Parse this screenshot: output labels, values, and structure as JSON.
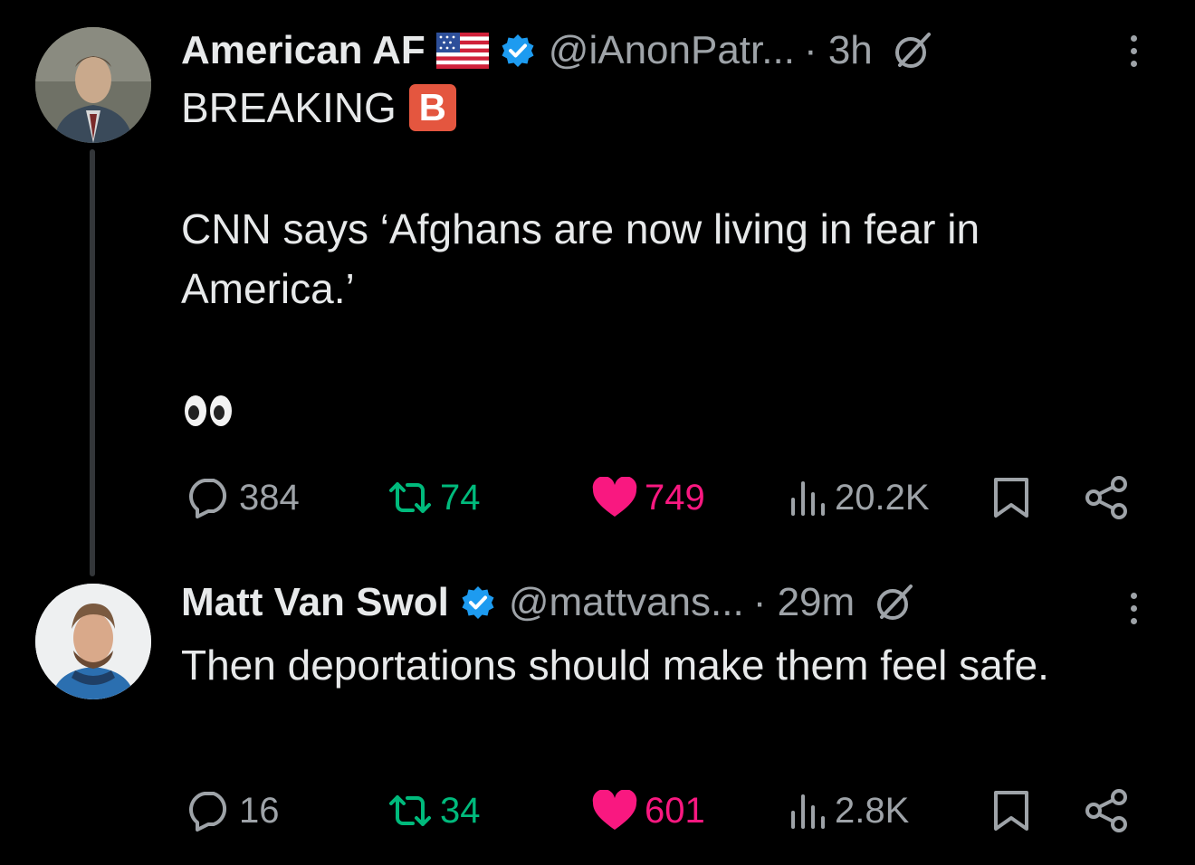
{
  "tweets": [
    {
      "display_name": "American AF",
      "handle": "@iAnonPatr...",
      "time": "· 3h",
      "badge_letter": "B",
      "line1": "BREAKING",
      "body": "CNN says ‘Afghans are now living in fear in America.’",
      "emoji": "👀",
      "replies": "384",
      "reposts": "74",
      "likes": "749",
      "views": "20.2K"
    },
    {
      "display_name": "Matt Van Swol",
      "handle": "@mattvans...",
      "time": "· 29m",
      "body": "Then deportations should make them feel safe.",
      "replies": "16",
      "reposts": "34",
      "likes": "601",
      "views": "2.8K"
    }
  ],
  "icons": {
    "verified": "verified-badge-icon",
    "flag": "us-flag-icon",
    "grok": "grok-icon",
    "more": "more-options-icon",
    "reply": "reply-icon",
    "repost": "repost-icon",
    "like": "heart-icon",
    "views": "views-icon",
    "bookmark": "bookmark-icon",
    "share": "share-icon"
  },
  "colors": {
    "background": "#000000",
    "text": "#e7e9ea",
    "muted": "#9ea3a8",
    "verified": "#1d9bf0",
    "repost": "#00ba7c",
    "like": "#f91880",
    "badge": "#e4563f"
  }
}
